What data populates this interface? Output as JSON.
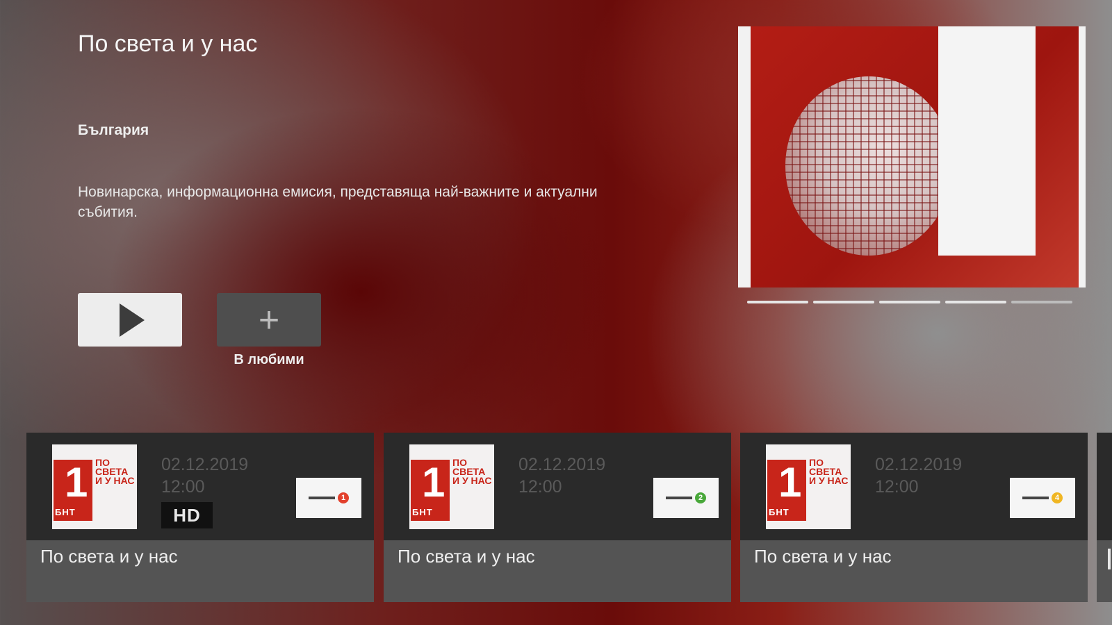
{
  "details": {
    "title": "По света и у нас",
    "country": "България",
    "description": "Новинарска, информационна емисия, представяща най-важните и актуални събития."
  },
  "actions": {
    "play_icon": "play-icon",
    "favorite_symbol": "+",
    "favorite_label": "В любими"
  },
  "hero": {
    "image": "bnt-1-globe-logo",
    "carousel_dots": 5
  },
  "episodes": [
    {
      "date": "02.12.2019",
      "time": "12:00",
      "badge": "HD",
      "channel_number": "1",
      "channel_color": "#e2402c",
      "name": "По света и у нас"
    },
    {
      "date": "02.12.2019",
      "time": "12:00",
      "badge": "",
      "channel_number": "2",
      "channel_color": "#49a83a",
      "name": "По света и у нас"
    },
    {
      "date": "02.12.2019",
      "time": "12:00",
      "badge": "",
      "channel_number": "4",
      "channel_color": "#f0b623",
      "name": "По света и у нас"
    }
  ],
  "thumb": {
    "digit": "1",
    "network": "БНТ",
    "show_text": "ПО СВЕТА И У НАС"
  }
}
